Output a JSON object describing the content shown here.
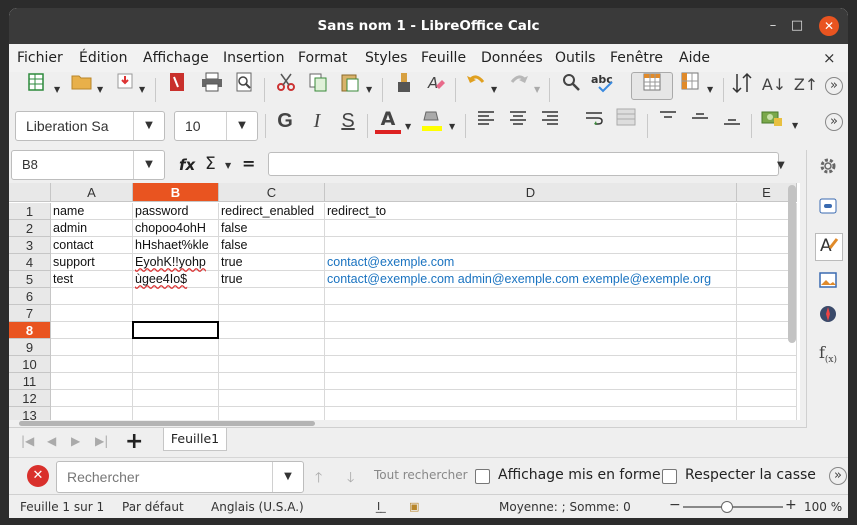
{
  "window": {
    "title": "Sans nom 1 - LibreOffice Calc",
    "minimize": "–",
    "maximize": "□",
    "close": "✕"
  },
  "menu": [
    "Fichier",
    "Édition",
    "Affichage",
    "Insertion",
    "Format",
    "Styles",
    "Feuille",
    "Données",
    "Outils",
    "Fenêtre",
    "Aide"
  ],
  "menu_close": "×",
  "toolbar": {
    "font_name": "Liberation Sa",
    "font_size": "10",
    "bold": "G",
    "italic": "I",
    "underline": "S",
    "font_color": "A",
    "sort_asc": "A↓",
    "sort_desc": "Z↑",
    "more": "»"
  },
  "formula_bar": {
    "name_box": "B8",
    "fx": "fx",
    "sigma": "Σ",
    "equals": "=",
    "content": ""
  },
  "columns": [
    {
      "label": "A",
      "selected": false
    },
    {
      "label": "B",
      "selected": true
    },
    {
      "label": "C",
      "selected": false
    },
    {
      "label": "D",
      "selected": false
    },
    {
      "label": "E",
      "selected": false
    }
  ],
  "rows": [
    {
      "num": "1",
      "selected": false,
      "cells": [
        "name",
        "password",
        "redirect_enabled",
        "redirect_to"
      ]
    },
    {
      "num": "2",
      "selected": false,
      "cells": [
        "admin",
        "chopoo4ohH",
        "false",
        ""
      ]
    },
    {
      "num": "3",
      "selected": false,
      "cells": [
        "contact",
        "hHshaet%kle",
        "false",
        ""
      ]
    },
    {
      "num": "4",
      "selected": false,
      "cells": [
        "support",
        "EyohK!!yohp",
        "true",
        "contact@exemple.com"
      ]
    },
    {
      "num": "5",
      "selected": false,
      "cells": [
        "test",
        "ùgee4Io$",
        "true",
        "contact@exemple.com admin@exemple.com exemple@exemple.org"
      ]
    },
    {
      "num": "6",
      "selected": false,
      "cells": [
        "",
        "",
        "",
        ""
      ]
    },
    {
      "num": "7",
      "selected": false,
      "cells": [
        "",
        "",
        "",
        ""
      ]
    },
    {
      "num": "8",
      "selected": true,
      "cells": [
        "",
        "",
        "",
        ""
      ]
    },
    {
      "num": "9",
      "selected": false,
      "cells": [
        "",
        "",
        "",
        ""
      ]
    },
    {
      "num": "10",
      "selected": false,
      "cells": [
        "",
        "",
        "",
        ""
      ]
    },
    {
      "num": "11",
      "selected": false,
      "cells": [
        "",
        "",
        "",
        ""
      ]
    },
    {
      "num": "12",
      "selected": false,
      "cells": [
        "",
        "",
        "",
        ""
      ]
    },
    {
      "num": "13",
      "selected": false,
      "cells": [
        "",
        "",
        "",
        ""
      ]
    }
  ],
  "sheet_tab": "Feuille1",
  "add_sheet": "+",
  "find": {
    "placeholder": "Rechercher",
    "find_all": "Tout rechercher",
    "formatted_display": "Affichage mis en forme",
    "match_case": "Respecter la casse"
  },
  "status": {
    "sheet": "Feuille 1 sur 1",
    "style": "Par défaut",
    "language": "Anglais (U.S.A.)",
    "sum": "Moyenne: ; Somme: 0",
    "zoom": "100 %",
    "zoom_minus": "−",
    "zoom_plus": "+"
  },
  "colors": {
    "accent": "#e95420",
    "link": "#1a73c0",
    "titlebar": "#3a3a3a"
  }
}
